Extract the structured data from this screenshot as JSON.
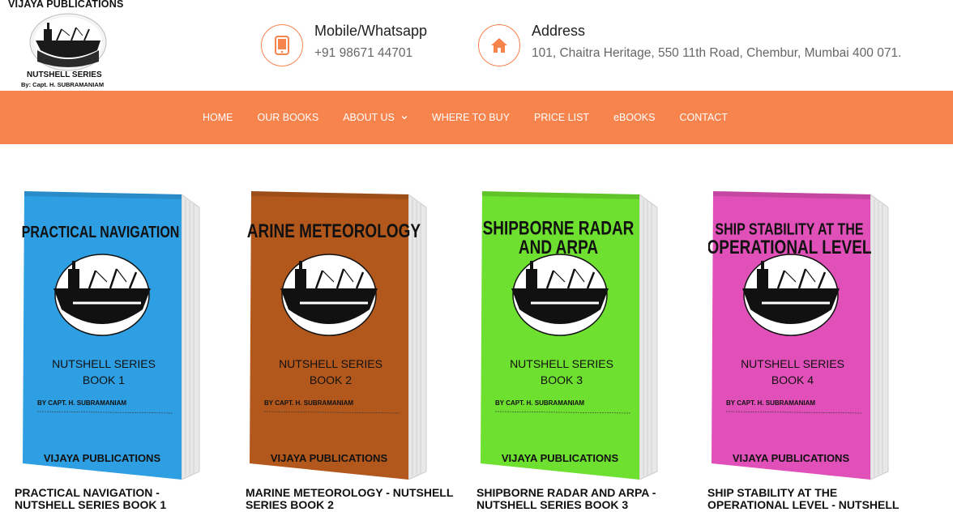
{
  "logo": {
    "title": "VIJAYA PUBLICATIONS",
    "subtitle": "NUTSHELL SERIES",
    "byline": "By: Capt. H. SUBRAMANIAM"
  },
  "contact": {
    "mobile_label": "Mobile/Whatsapp",
    "mobile_value": "+91 98671 44701",
    "mobile_icon": "phone-icon",
    "address_label": "Address",
    "address_value": "101, Chaitra Heritage, 550 11th Road, Chembur, Mumbai 400 071.",
    "address_icon": "home-icon",
    "accent_color": "#f7834d"
  },
  "nav": {
    "items": [
      "HOME",
      "OUR BOOKS",
      "ABOUT US",
      "WHERE TO BUY",
      "PRICE LIST",
      "eBOOKS",
      "CONTACT"
    ],
    "background": "#f7834d"
  },
  "books": [
    {
      "cover_title_line1": "PRACTICAL NAVIGATION",
      "cover_title_line2": "",
      "series": "NUTSHELL SERIES",
      "book_no": "BOOK 1",
      "author": "BY   CAPT.   H.   SUBRAMANIAM",
      "publisher": "VIJAYA PUBLICATIONS",
      "cover_color": "#2f9fe3",
      "title_line1": "PRACTICAL NAVIGATION -",
      "title_line2": "NUTSHELL SERIES BOOK 1"
    },
    {
      "cover_title_line1": "MARINE METEOROLOGY",
      "cover_title_line2": "",
      "series": "NUTSHELL SERIES",
      "book_no": "BOOK 2",
      "author": "BY   CAPT.   H.   SUBRAMANIAM",
      "publisher": "VIJAYA PUBLICATIONS",
      "cover_color": "#b3581c",
      "title_line1": "MARINE METEOROLOGY - NUTSHELL",
      "title_line2": "SERIES BOOK 2"
    },
    {
      "cover_title_line1": "SHIPBORNE RADAR",
      "cover_title_line2": "AND ARPA",
      "series": "NUTSHELL SERIES",
      "book_no": "BOOK 3",
      "author": "BY   CAPT.   H.   SUBRAMANIAM",
      "publisher": "VIJAYA PUBLICATIONS",
      "cover_color": "#6ee02f",
      "title_line1": "SHIPBORNE RADAR AND ARPA -",
      "title_line2": "NUTSHELL SERIES BOOK 3"
    },
    {
      "cover_title_line1": "SHIP STABILITY AT THE",
      "cover_title_line2": "OPERATIONAL LEVEL",
      "series": "NUTSHELL SERIES",
      "book_no": "BOOK 4",
      "author": "BY   CAPT.   H.   SUBRAMANIAM",
      "publisher": "VIJAYA PUBLICATIONS",
      "cover_color": "#e050b8",
      "title_line1": "SHIP STABILITY AT THE",
      "title_line2": "OPERATIONAL LEVEL - NUTSHELL"
    }
  ]
}
